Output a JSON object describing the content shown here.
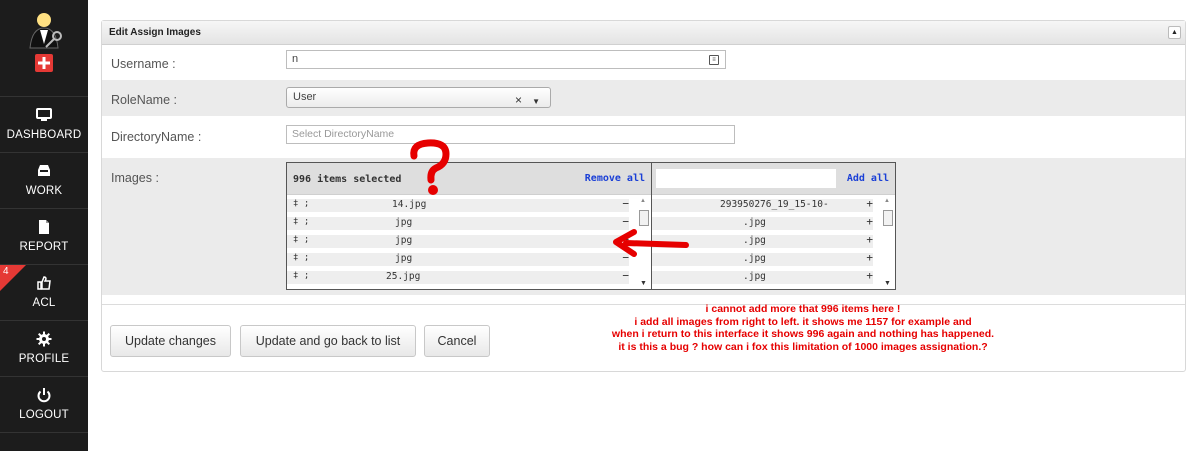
{
  "sidebar": {
    "badge_count": "4",
    "items": [
      {
        "label": "DASHBOARD",
        "icon": "monitor-icon"
      },
      {
        "label": "WORK",
        "icon": "inbox-icon"
      },
      {
        "label": "REPORT",
        "icon": "file-icon"
      },
      {
        "label": "ACL",
        "icon": "thumbs-up-icon"
      },
      {
        "label": "PROFILE",
        "icon": "gear-icon"
      },
      {
        "label": "LOGOUT",
        "icon": "power-icon"
      }
    ]
  },
  "panel": {
    "title": "Edit Assign Images",
    "fields": {
      "username_label": "Username :",
      "username_value": "n",
      "rolename_label": "RoleName :",
      "rolename_value": "User",
      "directory_label": "DirectoryName :",
      "directory_placeholder": "Select DirectoryName",
      "images_label": "Images :"
    },
    "selected_list": {
      "count_text": "996 items selected",
      "action": "Remove all",
      "items": [
        "14.jpg",
        "jpg",
        "jpg",
        "jpg",
        "25.jpg"
      ]
    },
    "available_list": {
      "action": "Add all",
      "items": [
        "293950276_19_15-10-",
        ".jpg",
        ".jpg",
        ".jpg",
        ".jpg"
      ]
    },
    "buttons": {
      "update": "Update changes",
      "update_back": "Update and go back to list",
      "cancel": "Cancel"
    }
  },
  "annotation": {
    "lines": [
      "i cannot add more that 996 items here !",
      "i add all images from right to left. it shows me 1157 for example and",
      "when i return to this interface it shows 996 again and nothing has happened.",
      "it is this a bug ? how can i fox this limitation of 1000 images assignation.?"
    ]
  },
  "colors": {
    "sidebar_bg": "#1c1c1c",
    "badge": "#e53935",
    "link": "#1a3fd6",
    "annotation": "#e60000"
  }
}
